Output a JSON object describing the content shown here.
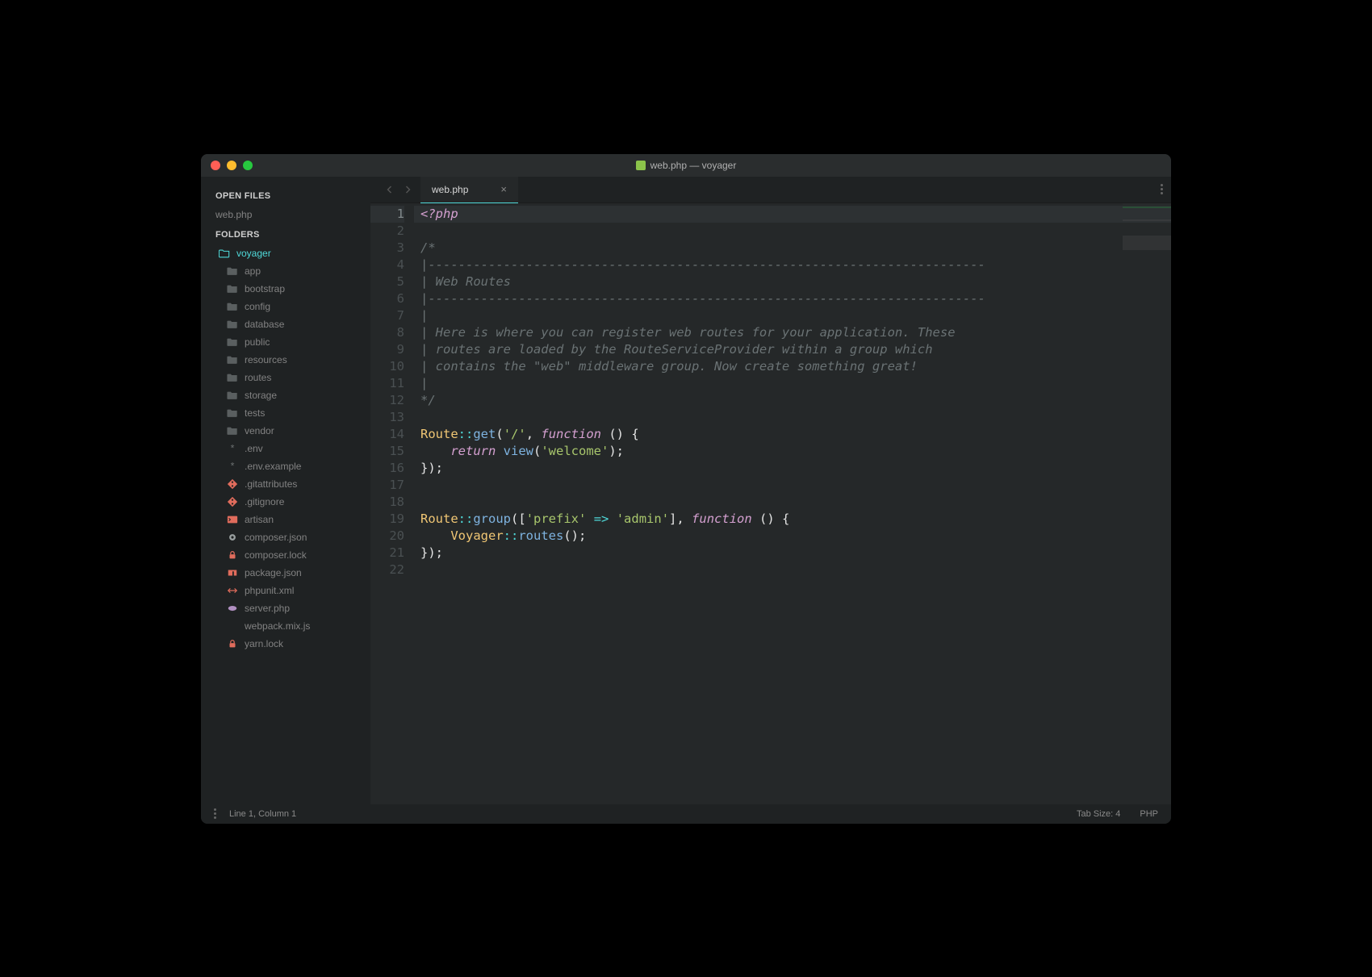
{
  "titlebar": {
    "title": "web.php — voyager"
  },
  "sidebar": {
    "section_open_files": "OPEN FILES",
    "open_files": [
      {
        "name": "web.php"
      }
    ],
    "section_folders": "FOLDERS",
    "root": "voyager",
    "folders": [
      {
        "name": "app"
      },
      {
        "name": "bootstrap"
      },
      {
        "name": "config"
      },
      {
        "name": "database"
      },
      {
        "name": "public"
      },
      {
        "name": "resources"
      },
      {
        "name": "routes"
      },
      {
        "name": "storage"
      },
      {
        "name": "tests"
      },
      {
        "name": "vendor"
      }
    ],
    "files": [
      {
        "name": ".env",
        "icon": "asterisk",
        "color": "#6b7070"
      },
      {
        "name": ".env.example",
        "icon": "asterisk",
        "color": "#6b7070"
      },
      {
        "name": ".gitattributes",
        "icon": "git",
        "color": "#e06c5c"
      },
      {
        "name": ".gitignore",
        "icon": "git",
        "color": "#e06c5c"
      },
      {
        "name": "artisan",
        "icon": "terminal",
        "color": "#e06c5c"
      },
      {
        "name": "composer.json",
        "icon": "gear",
        "color": "#9aa0a0"
      },
      {
        "name": "composer.lock",
        "icon": "lock",
        "color": "#e06c5c"
      },
      {
        "name": "package.json",
        "icon": "npm",
        "color": "#e06c5c"
      },
      {
        "name": "phpunit.xml",
        "icon": "xml",
        "color": "#e06c5c"
      },
      {
        "name": "server.php",
        "icon": "php",
        "color": "#b08fc0"
      },
      {
        "name": "webpack.mix.js",
        "icon": "blank",
        "color": "#6b7070"
      },
      {
        "name": "yarn.lock",
        "icon": "lock",
        "color": "#e06c5c"
      }
    ]
  },
  "tab": {
    "label": "web.php"
  },
  "code": {
    "lines": [
      [
        {
          "t": "<?php",
          "c": "c-kw"
        }
      ],
      [],
      [
        {
          "t": "/*",
          "c": "c-cmt"
        }
      ],
      [
        {
          "t": "|--------------------------------------------------------------------------",
          "c": "c-cmt"
        }
      ],
      [
        {
          "t": "| Web Routes",
          "c": "c-cmt"
        }
      ],
      [
        {
          "t": "|--------------------------------------------------------------------------",
          "c": "c-cmt"
        }
      ],
      [
        {
          "t": "|",
          "c": "c-cmt"
        }
      ],
      [
        {
          "t": "| Here is where you can register web routes for your application. These",
          "c": "c-cmt"
        }
      ],
      [
        {
          "t": "| routes are loaded by the RouteServiceProvider within a group which",
          "c": "c-cmt"
        }
      ],
      [
        {
          "t": "| contains the \"web\" middleware group. Now create something great!",
          "c": "c-cmt"
        }
      ],
      [
        {
          "t": "|",
          "c": "c-cmt"
        }
      ],
      [
        {
          "t": "*/",
          "c": "c-cmt"
        }
      ],
      [],
      [
        {
          "t": "Route",
          "c": "c-cls"
        },
        {
          "t": "::",
          "c": "c-op"
        },
        {
          "t": "get",
          "c": "c-fn"
        },
        {
          "t": "(",
          "c": "c-pl"
        },
        {
          "t": "'/'",
          "c": "c-str"
        },
        {
          "t": ", ",
          "c": "c-pl"
        },
        {
          "t": "function",
          "c": "c-kw2"
        },
        {
          "t": " () {",
          "c": "c-pl"
        }
      ],
      [
        {
          "t": "    ",
          "c": "c-pl"
        },
        {
          "t": "return",
          "c": "c-kw2"
        },
        {
          "t": " ",
          "c": "c-pl"
        },
        {
          "t": "view",
          "c": "c-fn"
        },
        {
          "t": "(",
          "c": "c-pl"
        },
        {
          "t": "'welcome'",
          "c": "c-str"
        },
        {
          "t": ");",
          "c": "c-pl"
        }
      ],
      [
        {
          "t": "});",
          "c": "c-pl"
        }
      ],
      [],
      [],
      [
        {
          "t": "Route",
          "c": "c-cls"
        },
        {
          "t": "::",
          "c": "c-op"
        },
        {
          "t": "group",
          "c": "c-fn"
        },
        {
          "t": "([",
          "c": "c-pl"
        },
        {
          "t": "'prefix'",
          "c": "c-str"
        },
        {
          "t": " ",
          "c": "c-pl"
        },
        {
          "t": "=>",
          "c": "c-op"
        },
        {
          "t": " ",
          "c": "c-pl"
        },
        {
          "t": "'admin'",
          "c": "c-str"
        },
        {
          "t": "], ",
          "c": "c-pl"
        },
        {
          "t": "function",
          "c": "c-kw2"
        },
        {
          "t": " () {",
          "c": "c-pl"
        }
      ],
      [
        {
          "t": "    ",
          "c": "c-pl"
        },
        {
          "t": "Voyager",
          "c": "c-cls"
        },
        {
          "t": "::",
          "c": "c-op"
        },
        {
          "t": "routes",
          "c": "c-fn"
        },
        {
          "t": "();",
          "c": "c-pl"
        }
      ],
      [
        {
          "t": "});",
          "c": "c-pl"
        }
      ],
      []
    ],
    "active_line": 1
  },
  "status": {
    "position": "Line 1, Column 1",
    "tabsize": "Tab Size: 4",
    "lang": "PHP"
  }
}
